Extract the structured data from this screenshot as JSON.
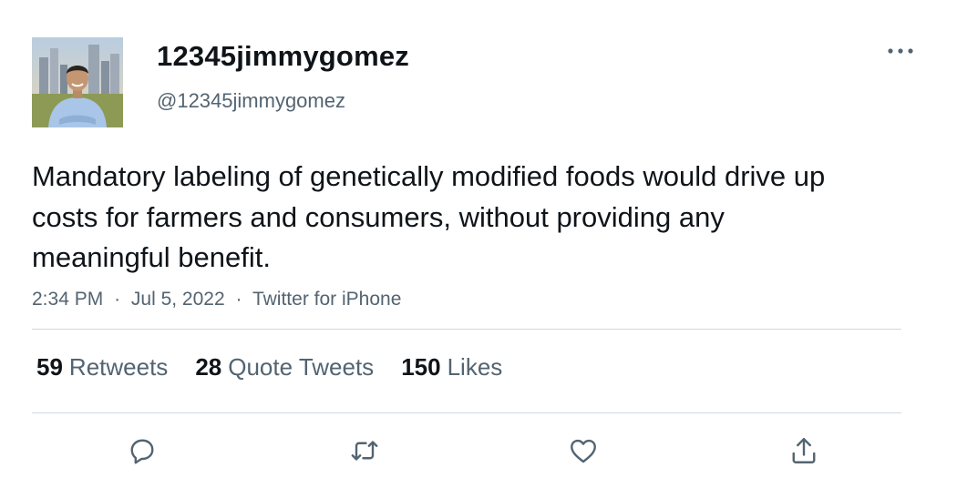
{
  "author": {
    "display_name": "12345jimmygomez",
    "handle": "@12345jimmygomez"
  },
  "tweet": {
    "text": "Mandatory labeling of genetically modified foods would drive up costs for farmers and consumers, without providing any meaningful benefit.",
    "time": "2:34 PM",
    "separator": "·",
    "date": "Jul 5, 2022",
    "source": "Twitter for iPhone"
  },
  "stats": {
    "retweets_count": "59",
    "retweets_label": "Retweets",
    "quotes_count": "28",
    "quotes_label": "Quote Tweets",
    "likes_count": "150",
    "likes_label": "Likes"
  },
  "icons": {
    "more": "more-horizontal-icon",
    "reply": "reply-icon",
    "retweet": "retweet-icon",
    "like": "heart-icon",
    "share": "share-icon"
  },
  "colors": {
    "text_primary": "#0f1419",
    "text_secondary": "#536471",
    "divider": "#cfd9de"
  }
}
